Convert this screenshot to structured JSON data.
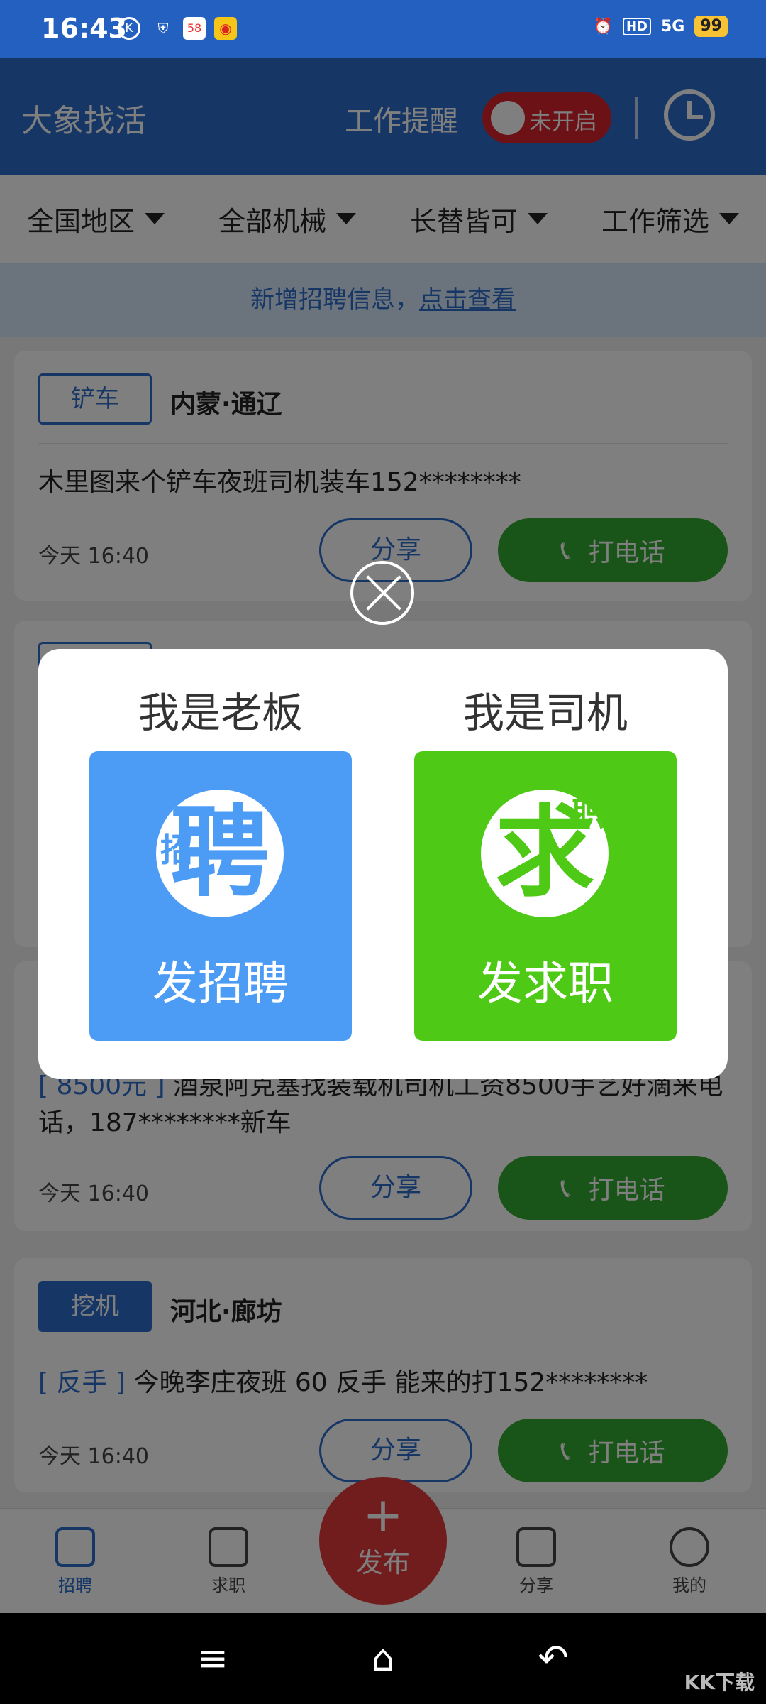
{
  "status_bar": {
    "time": "16:43",
    "icons": [
      "k-icon",
      "shield-icon",
      "58-icon",
      "weibo-icon"
    ],
    "right_icons": [
      "alarm-icon",
      "hd-icon",
      "5g-signal-icon"
    ],
    "network": "5G",
    "hd": "HD",
    "battery": "99"
  },
  "header": {
    "app_title": "大象找活",
    "reminder_label": "工作提醒",
    "toggle_text": "未开启"
  },
  "filters": [
    {
      "label": "全国地区"
    },
    {
      "label": "全部机械"
    },
    {
      "label": "长替皆可"
    },
    {
      "label": "工作筛选"
    }
  ],
  "notice": {
    "text": "新增招聘信息，",
    "link": "点击查看"
  },
  "cards": [
    {
      "tag": "铲车",
      "location": "内蒙·通辽",
      "highlight": "",
      "desc": "木里图来个铲车夜班司机装车152********",
      "time": "今天 16:40",
      "share": "分享",
      "call": "打电话"
    },
    {
      "tag": "",
      "location": "",
      "highlight": "[ 8500元 ]",
      "desc": "酒泉阿克塞找装载机司机工资8500手艺好滴来电话，187********新车",
      "time": "今天 16:40",
      "share": "分享",
      "call": "打电话"
    },
    {
      "tag": "挖机",
      "location": "河北·廊坊",
      "highlight": "[ 反手 ]",
      "desc": "今晚李庄夜班 60 反手 能来的打152********",
      "time": "今天 16:40",
      "share": "分享",
      "call": "打电话"
    }
  ],
  "bottom_nav": {
    "items": [
      {
        "label": "招聘",
        "active": true
      },
      {
        "label": "求职",
        "active": false
      },
      {
        "label": "分享",
        "active": false
      },
      {
        "label": "我的",
        "active": false
      }
    ],
    "publish_plus": "+",
    "publish_label": "发布"
  },
  "dialog": {
    "boss_title": "我是老板",
    "boss_circle_big": "聘",
    "boss_circle_small": "招",
    "boss_action": "发招聘",
    "driver_title": "我是司机",
    "driver_circle_big": "求",
    "driver_circle_small": "职",
    "driver_action": "发求职"
  },
  "watermark": "KK下载"
}
